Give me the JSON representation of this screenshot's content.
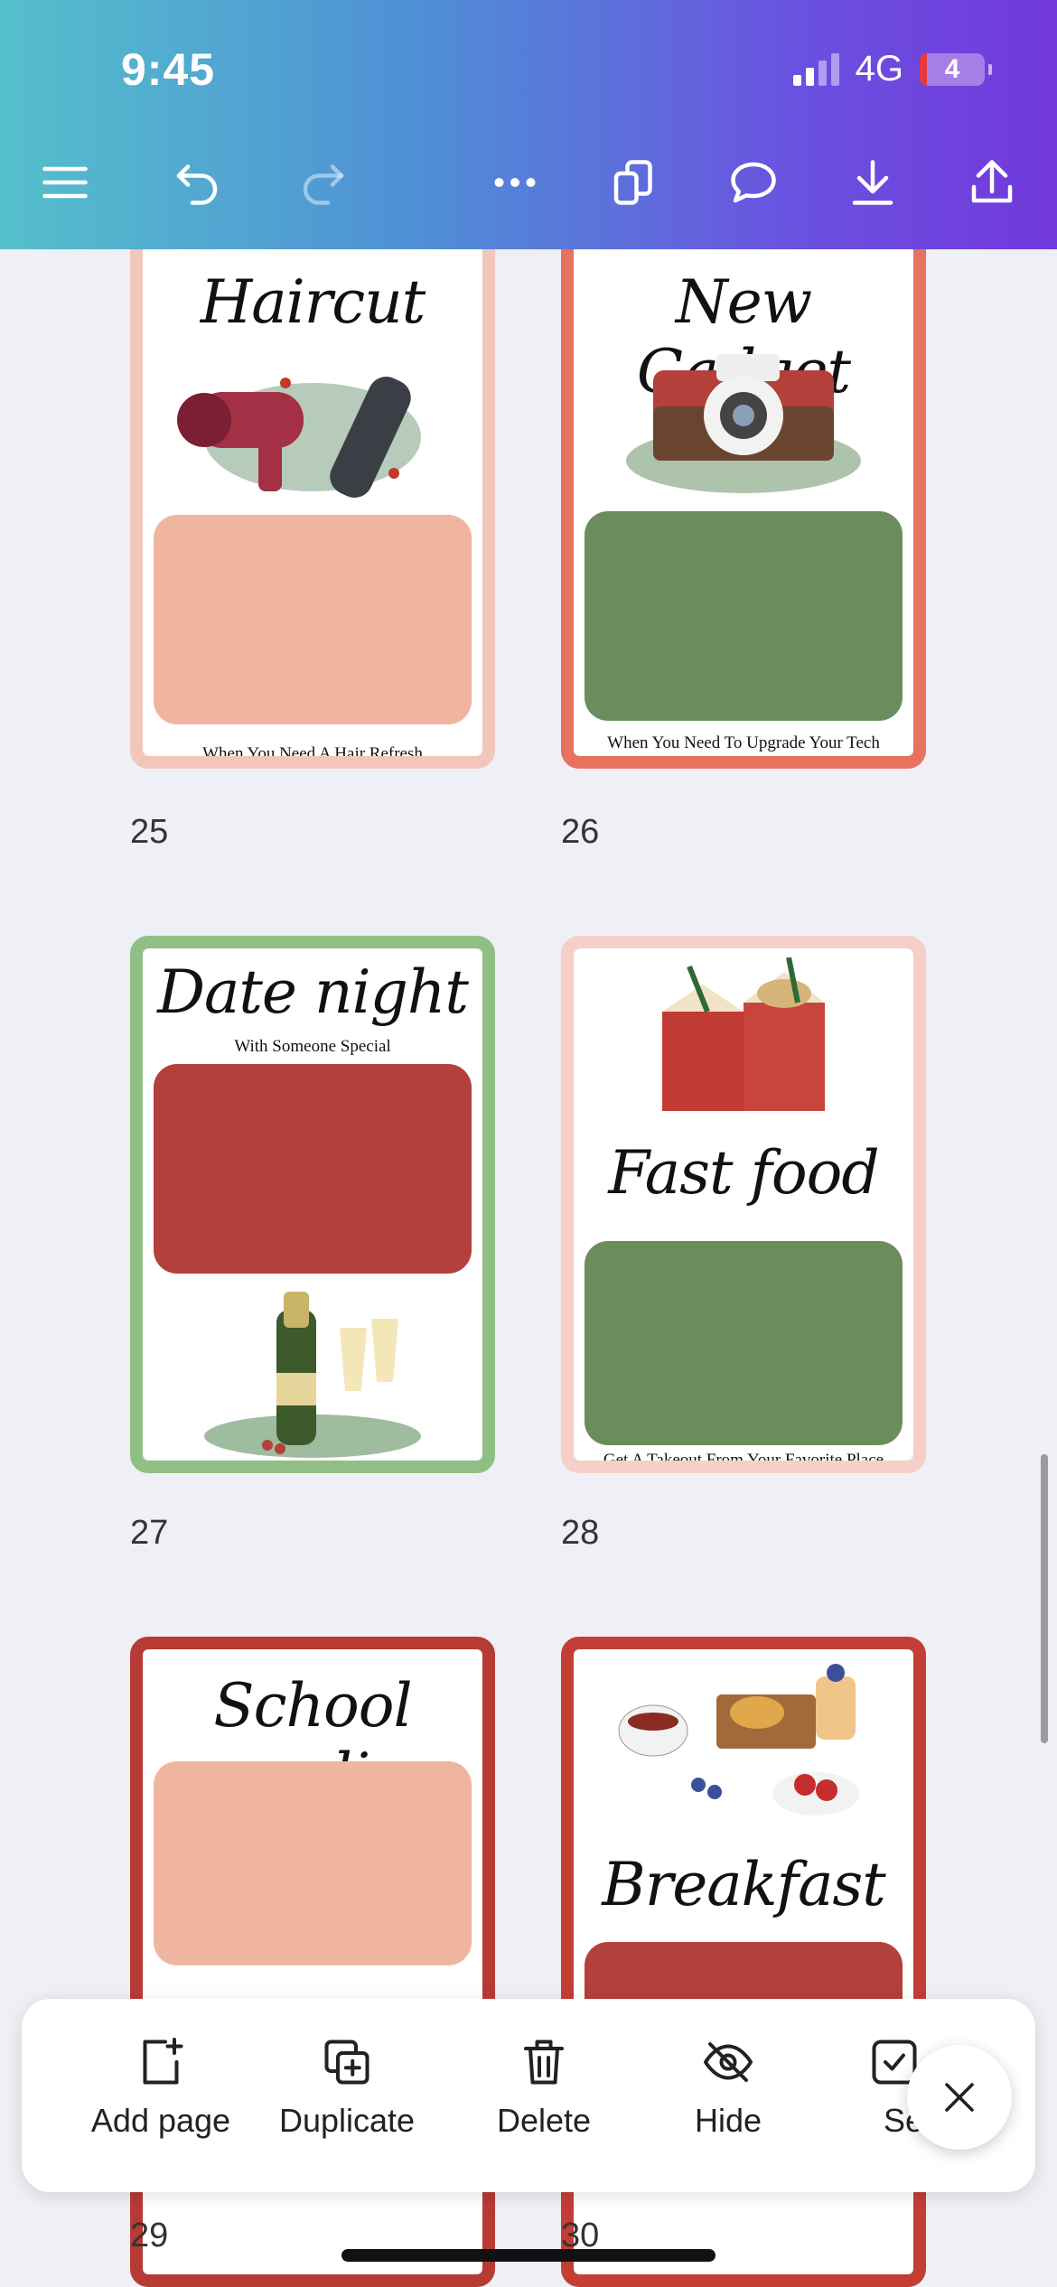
{
  "status_bar": {
    "time": "9:45",
    "network": "4G",
    "battery": "4"
  },
  "toolbar": {
    "icons": [
      "menu-icon",
      "undo-icon",
      "redo-icon",
      "more-icon",
      "pages-icon",
      "comment-icon",
      "download-icon",
      "share-icon"
    ]
  },
  "pages": [
    {
      "number": "25",
      "title": "Haircut",
      "subtitle": "When You Need A Hair Refresh"
    },
    {
      "number": "26",
      "title": "New Gadget",
      "subtitle": "When You Need To Upgrade Your Tech"
    },
    {
      "number": "27",
      "title": "Date night",
      "subtitle": "With Someone Special"
    },
    {
      "number": "28",
      "title": "Fast food",
      "subtitle": "Get A Takeout From Your Favorite Place"
    },
    {
      "number": "29",
      "title": "School supplies",
      "subtitle": ""
    },
    {
      "number": "30",
      "title": "Breakfast",
      "subtitle": ""
    }
  ],
  "actions": [
    {
      "label": "Add page",
      "icon": "add-page-icon"
    },
    {
      "label": "Duplicate",
      "icon": "duplicate-icon"
    },
    {
      "label": "Delete",
      "icon": "trash-icon"
    },
    {
      "label": "Hide",
      "icon": "eye-slash-icon"
    },
    {
      "label": "Sel",
      "icon": "select-icon"
    }
  ],
  "colors": {
    "header_start": "#55bfcb",
    "header_end": "#7238dc",
    "pink": "#f0b5a0",
    "green": "#6b8d5d",
    "red": "#b3403a"
  }
}
